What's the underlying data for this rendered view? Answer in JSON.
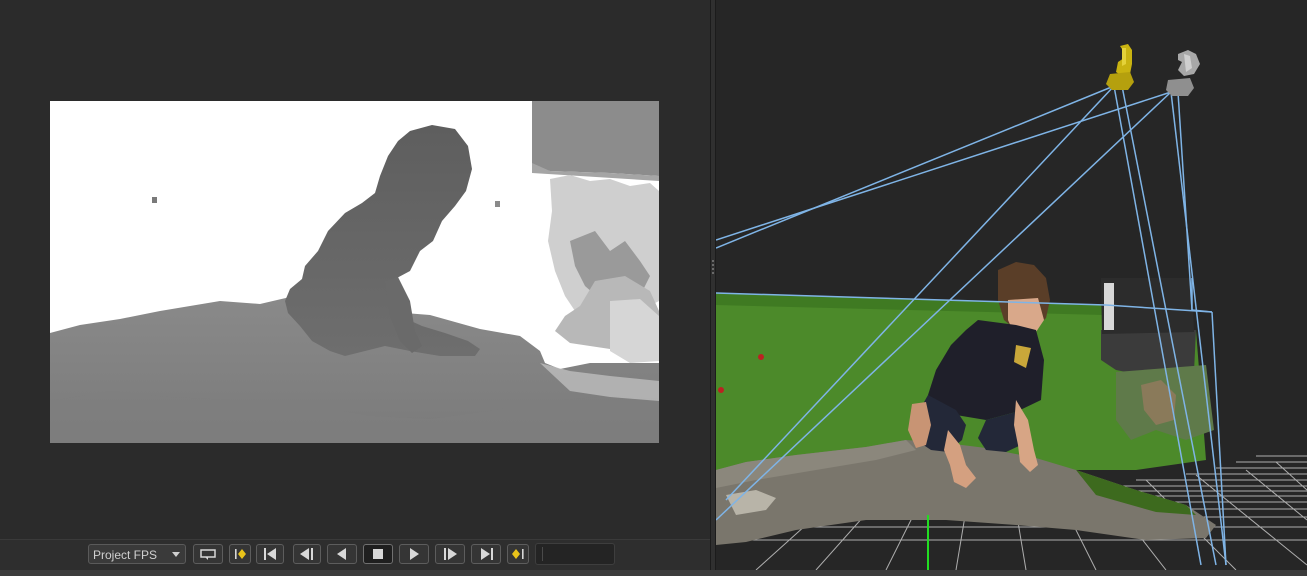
{
  "transport": {
    "fps_label": "Project FPS",
    "buttons": [
      {
        "name": "loop-playback-button",
        "icon": "loop-icon"
      },
      {
        "name": "prev-keyframe-button",
        "icon": "prev-keyframe-icon"
      },
      {
        "name": "go-to-start-button",
        "icon": "go-to-start-icon"
      },
      {
        "name": "step-back-button",
        "icon": "step-back-icon"
      },
      {
        "name": "play-reverse-button",
        "icon": "play-reverse-icon"
      },
      {
        "name": "stop-button",
        "icon": "stop-icon"
      },
      {
        "name": "play-button",
        "icon": "play-icon"
      },
      {
        "name": "step-forward-button",
        "icon": "step-forward-icon"
      },
      {
        "name": "go-to-end-button",
        "icon": "go-to-end-icon"
      },
      {
        "name": "next-keyframe-button",
        "icon": "next-keyframe-icon"
      }
    ],
    "time_value": ""
  },
  "left_viewer": {
    "content": "depth-map-image"
  },
  "right_viewer": {
    "content": "3d-scene-point-cloud"
  },
  "colors": {
    "panel_bg": "#2b2b2b",
    "keyframe_accent": "#e8c21a",
    "frustum_line": "#7fb4e6",
    "camera_active": "#c9b311",
    "camera_inactive": "#9a9a9a",
    "grid_line": "#bfbfbf",
    "axis_green": "#22dd22"
  }
}
